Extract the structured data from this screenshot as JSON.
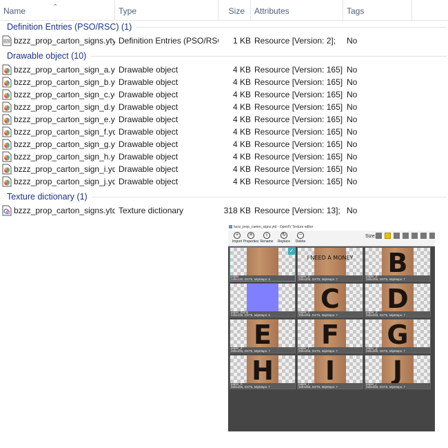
{
  "columns": {
    "name": "Name",
    "type": "Type",
    "size": "Size",
    "attributes": "Attributes",
    "tags": "Tags"
  },
  "groups": [
    {
      "label": "Definition Entries (PSO/RSC) (1)",
      "icon": "ytyp-file-icon",
      "rows": [
        {
          "name": "bzzz_prop_carton_signs.ytyp",
          "type": "Definition Entries (PSO/RSC)",
          "size": "1 KB",
          "attributes": "Resource [Version: 2];",
          "tags": "No"
        }
      ]
    },
    {
      "label": "Drawable object (10)",
      "icon": "ydr-file-icon",
      "rows": [
        {
          "name": "bzzz_prop_carton_sign_a.ydr",
          "type": "Drawable object",
          "size": "4 KB",
          "attributes": "Resource [Version: 165];",
          "tags": "No"
        },
        {
          "name": "bzzz_prop_carton_sign_b.ydr",
          "type": "Drawable object",
          "size": "4 KB",
          "attributes": "Resource [Version: 165];",
          "tags": "No"
        },
        {
          "name": "bzzz_prop_carton_sign_c.ydr",
          "type": "Drawable object",
          "size": "4 KB",
          "attributes": "Resource [Version: 165];",
          "tags": "No"
        },
        {
          "name": "bzzz_prop_carton_sign_d.ydr",
          "type": "Drawable object",
          "size": "4 KB",
          "attributes": "Resource [Version: 165];",
          "tags": "No"
        },
        {
          "name": "bzzz_prop_carton_sign_e.ydr",
          "type": "Drawable object",
          "size": "4 KB",
          "attributes": "Resource [Version: 165];",
          "tags": "No"
        },
        {
          "name": "bzzz_prop_carton_sign_f.ydr",
          "type": "Drawable object",
          "size": "4 KB",
          "attributes": "Resource [Version: 165];",
          "tags": "No"
        },
        {
          "name": "bzzz_prop_carton_sign_g.ydr",
          "type": "Drawable object",
          "size": "4 KB",
          "attributes": "Resource [Version: 165];",
          "tags": "No"
        },
        {
          "name": "bzzz_prop_carton_sign_h.ydr",
          "type": "Drawable object",
          "size": "4 KB",
          "attributes": "Resource [Version: 165];",
          "tags": "No"
        },
        {
          "name": "bzzz_prop_carton_sign_i.ydr",
          "type": "Drawable object",
          "size": "4 KB",
          "attributes": "Resource [Version: 165];",
          "tags": "No"
        },
        {
          "name": "bzzz_prop_carton_sign_j.ydr",
          "type": "Drawable object",
          "size": "4 KB",
          "attributes": "Resource [Version: 165];",
          "tags": "No"
        }
      ]
    },
    {
      "label": "Texture dictionary (1)",
      "icon": "ytd-file-icon",
      "rows": [
        {
          "name": "bzzz_prop_carton_signs.ytd",
          "type": "Texture dictionary",
          "size": "318 KB",
          "attributes": "Resource [Version: 13];",
          "tags": "No"
        }
      ]
    }
  ],
  "texture_editor": {
    "title": "bzzz_prop_carton_signs.ytd - OpenIV Texture editor",
    "toolbar": [
      "Import",
      "Properties",
      "Rename",
      "Replace",
      "Delete"
    ],
    "size_label": "Size:",
    "textures": [
      {
        "caption": "paper",
        "info": "128x128, DXT5, MipMaps: 6",
        "kind": "wood",
        "label": ""
      },
      {
        "caption": "paper_a",
        "info": "256x256, DXT5, MipMaps: 7",
        "kind": "wood",
        "label": "I NEED A MONEY"
      },
      {
        "caption": "paper_b",
        "info": "256x256, DXT5, MipMaps: 7",
        "kind": "wood",
        "label": "B"
      },
      {
        "caption": "paper_bump",
        "info": "128x128, DXT5, MipMaps: 6",
        "kind": "blue",
        "label": ""
      },
      {
        "caption": "paper_c",
        "info": "256x256, DXT5, MipMaps: 7",
        "kind": "wood",
        "label": "C"
      },
      {
        "caption": "paper_d",
        "info": "256x256, DXT5, MipMaps: 7",
        "kind": "wood",
        "label": "D"
      },
      {
        "caption": "paper_e",
        "info": "256x256, DXT5, MipMaps: 7",
        "kind": "wood",
        "label": "E"
      },
      {
        "caption": "paper_f",
        "info": "256x256, DXT5, MipMaps: 7",
        "kind": "wood",
        "label": "F"
      },
      {
        "caption": "paper_g",
        "info": "256x256, DXT5, MipMaps: 7",
        "kind": "wood",
        "label": "G"
      },
      {
        "caption": "paper_h",
        "info": "256x256, DXT5, MipMaps: 7",
        "kind": "wood",
        "label": "H"
      },
      {
        "caption": "paper_i",
        "info": "256x256, DXT5, MipMaps: 7",
        "kind": "wood",
        "label": "I"
      },
      {
        "caption": "paper_j",
        "info": "256x256, DXT5, MipMaps: 7",
        "kind": "wood",
        "label": "J"
      }
    ]
  },
  "colors": {
    "group_header": "#1e3287",
    "column_header": "#4c607a",
    "selection": "#3ab0b8"
  }
}
